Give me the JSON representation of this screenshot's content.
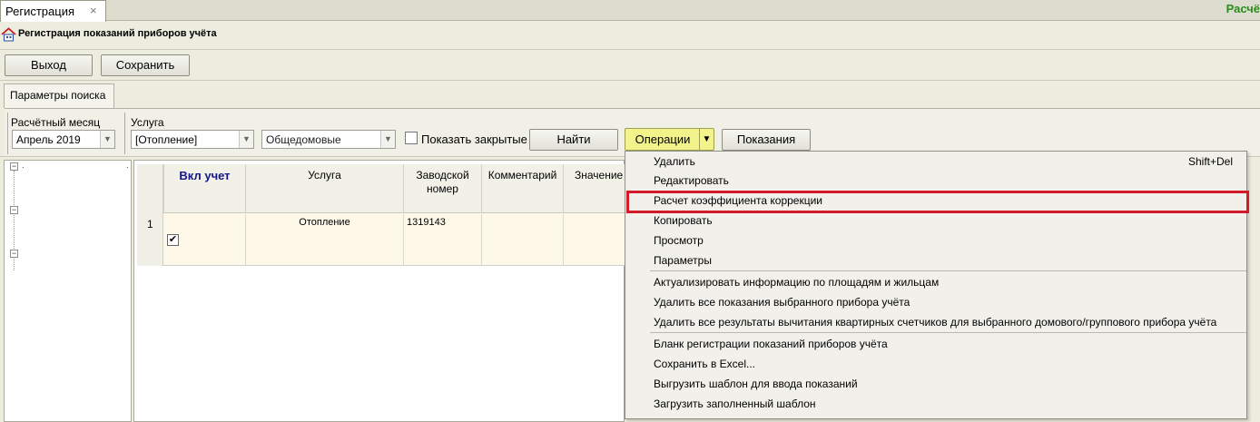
{
  "tab": {
    "label": "Регистрация",
    "close": "×"
  },
  "right_title": "Расчё",
  "window": {
    "title": "Регистрация показаний приборов учёта",
    "logo_icon": "house-logo-icon"
  },
  "toolbar": {
    "exit_label": "Выход",
    "save_label": "Сохранить"
  },
  "params_tab": {
    "label": "Параметры поиска"
  },
  "filters": {
    "month_label": "Расчётный месяц",
    "month_value": "Апрель 2019",
    "service_label": "Услуга",
    "service_value": "[Отопление]",
    "building_value": "Общедомовые",
    "show_closed_label": "Показать закрытые",
    "show_closed_checked": false,
    "find_label": "Найти",
    "operations_label": "Операции",
    "readings_label": "Показания"
  },
  "tree": {
    "node_1": ".",
    "node_2": "."
  },
  "grid": {
    "columns": {
      "incl": "Вкл учет",
      "service": "Услуга",
      "serial": "Заводской номер",
      "comment": "Комментарий",
      "value": "Значение"
    },
    "rows": [
      {
        "num": "1",
        "checked": "✔",
        "service": "Отопление",
        "serial": "1319143",
        "comment": "",
        "value": ""
      }
    ]
  },
  "menu": {
    "items": [
      {
        "label": "Удалить",
        "shortcut": "Shift+Del"
      },
      {
        "label": "Редактировать"
      },
      {
        "label": "Расчет коэффициента коррекции",
        "highlighted": true
      },
      {
        "label": "Копировать"
      },
      {
        "label": "Просмотр"
      },
      {
        "label": "Параметры"
      },
      {
        "label": "Актуализировать информацию по площадям и жильцам"
      },
      {
        "label": "Удалить все показания выбранного прибора учёта"
      },
      {
        "label": "Удалить все результаты вычитания квартирных счетчиков для выбранного домового/группового прибора учёта"
      },
      {
        "label": "Бланк регистрации показаний приборов учёта"
      },
      {
        "label": "Сохранить в Excel..."
      },
      {
        "label": "Выгрузить шаблон для ввода показаний"
      },
      {
        "label": "Загрузить заполненный шаблон"
      }
    ]
  },
  "colors": {
    "highlight_border": "#d21a2a",
    "operations_button": "#f3f38c",
    "right_title": "#2c8c1c"
  }
}
